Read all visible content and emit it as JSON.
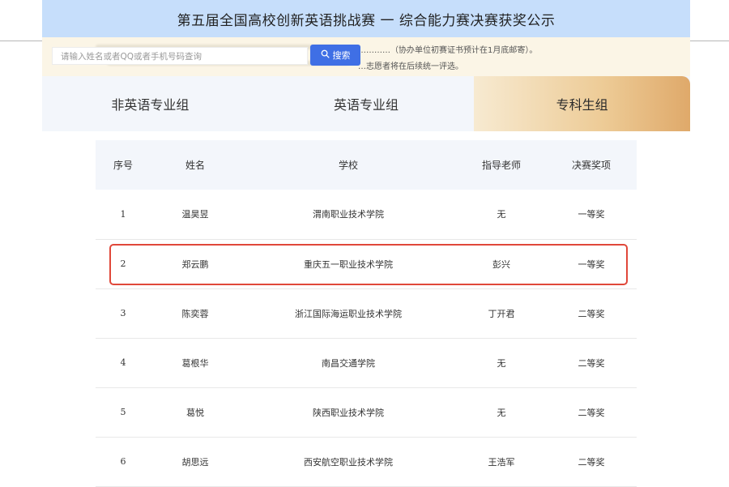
{
  "header": {
    "title": "第五届全国高校创新英语挑战赛 一 综合能力赛决赛获奖公示"
  },
  "notice": {
    "line1": "本…………（协办单位初赛证书预计在1月底邮寄）。",
    "line2": "…志愿者将在后续统一评选。"
  },
  "search": {
    "placeholder": "请输入姓名或者QQ或者手机号码查询",
    "button_label": "搜索",
    "button_icon": "search-icon"
  },
  "tabs": [
    {
      "label": "非英语专业组"
    },
    {
      "label": "英语专业组"
    },
    {
      "label": "专科生组"
    }
  ],
  "active_tab": "专科生组",
  "table": {
    "headers": [
      "序号",
      "姓名",
      "学校",
      "指导老师",
      "决赛奖项"
    ],
    "rows": [
      [
        "1",
        "温昊昱",
        "渭南职业技术学院",
        "无",
        "一等奖"
      ],
      [
        "2",
        "郑云鹏",
        "重庆五一职业技术学院",
        "彭兴",
        "一等奖"
      ],
      [
        "3",
        "陈奕蓉",
        "浙江国际海运职业技术学院",
        "丁开君",
        "二等奖"
      ],
      [
        "4",
        "葛根华",
        "南昌交通学院",
        "无",
        "二等奖"
      ],
      [
        "5",
        "葛悦",
        "陕西职业技术学院",
        "无",
        "二等奖"
      ],
      [
        "6",
        "胡思远",
        "西安航空职业技术学院",
        "王浩军",
        "二等奖"
      ]
    ]
  },
  "colors": {
    "header_bg": "#c6defb",
    "search_button": "#3f6fe5",
    "active_tab_gradient_end": "#dfa96a",
    "highlight_border": "#e0483a"
  }
}
